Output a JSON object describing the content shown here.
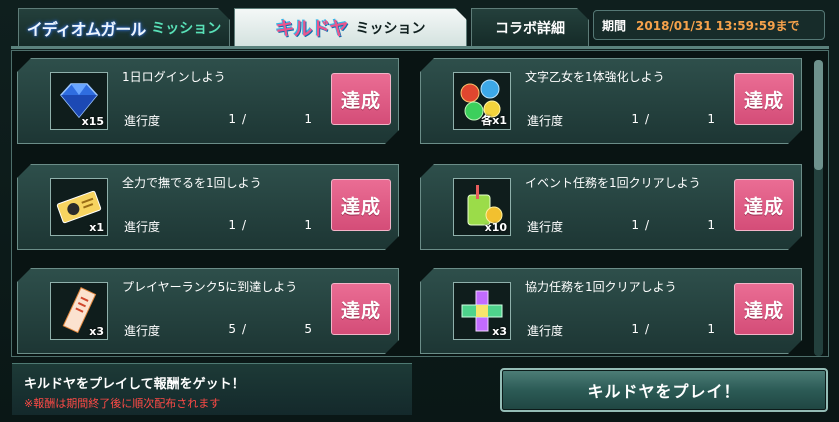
{
  "tabs": [
    {
      "logo": "イディオムガール",
      "label": "ミッション"
    },
    {
      "logo": "キルドヤ",
      "label": "ミッション"
    },
    {
      "label": "コラボ詳細"
    }
  ],
  "period": {
    "label": "期間",
    "value": "2018/01/31 13:59:59まで"
  },
  "progress_label": "進行度",
  "missions": [
    {
      "title": "1日ログインしよう",
      "icon": "diamond-icon",
      "qty": "x15",
      "current": "1",
      "max": "1",
      "button": "達成"
    },
    {
      "title": "文字乙女を1体強化しよう",
      "icon": "orbs-icon",
      "qty": "各x1",
      "current": "1",
      "max": "1",
      "button": "達成"
    },
    {
      "title": "全力で撫でるを1回しよう",
      "icon": "ticket-icon",
      "qty": "x1",
      "current": "1",
      "max": "1",
      "button": "達成"
    },
    {
      "title": "イベント任務を1回クリアしよう",
      "icon": "juice-icon",
      "qty": "x10",
      "current": "1",
      "max": "1",
      "button": "達成"
    },
    {
      "title": "プレイヤーランク5に到達しよう",
      "icon": "talisman-icon",
      "qty": "x3",
      "current": "5",
      "max": "5",
      "button": "達成"
    },
    {
      "title": "協力任務を1回クリアしよう",
      "icon": "cross-gem-icon",
      "qty": "x3",
      "current": "1",
      "max": "1",
      "button": "達成"
    }
  ],
  "footer": {
    "message": "キルドヤをプレイして報酬をゲット！",
    "note": "※報酬は期間終了後に順次配布されます",
    "play_button": "キルドヤをプレイ！"
  },
  "colors": {
    "accent_pink": "#e05b85",
    "period_value": "#f6a24b",
    "note_red": "#ff4a46"
  }
}
